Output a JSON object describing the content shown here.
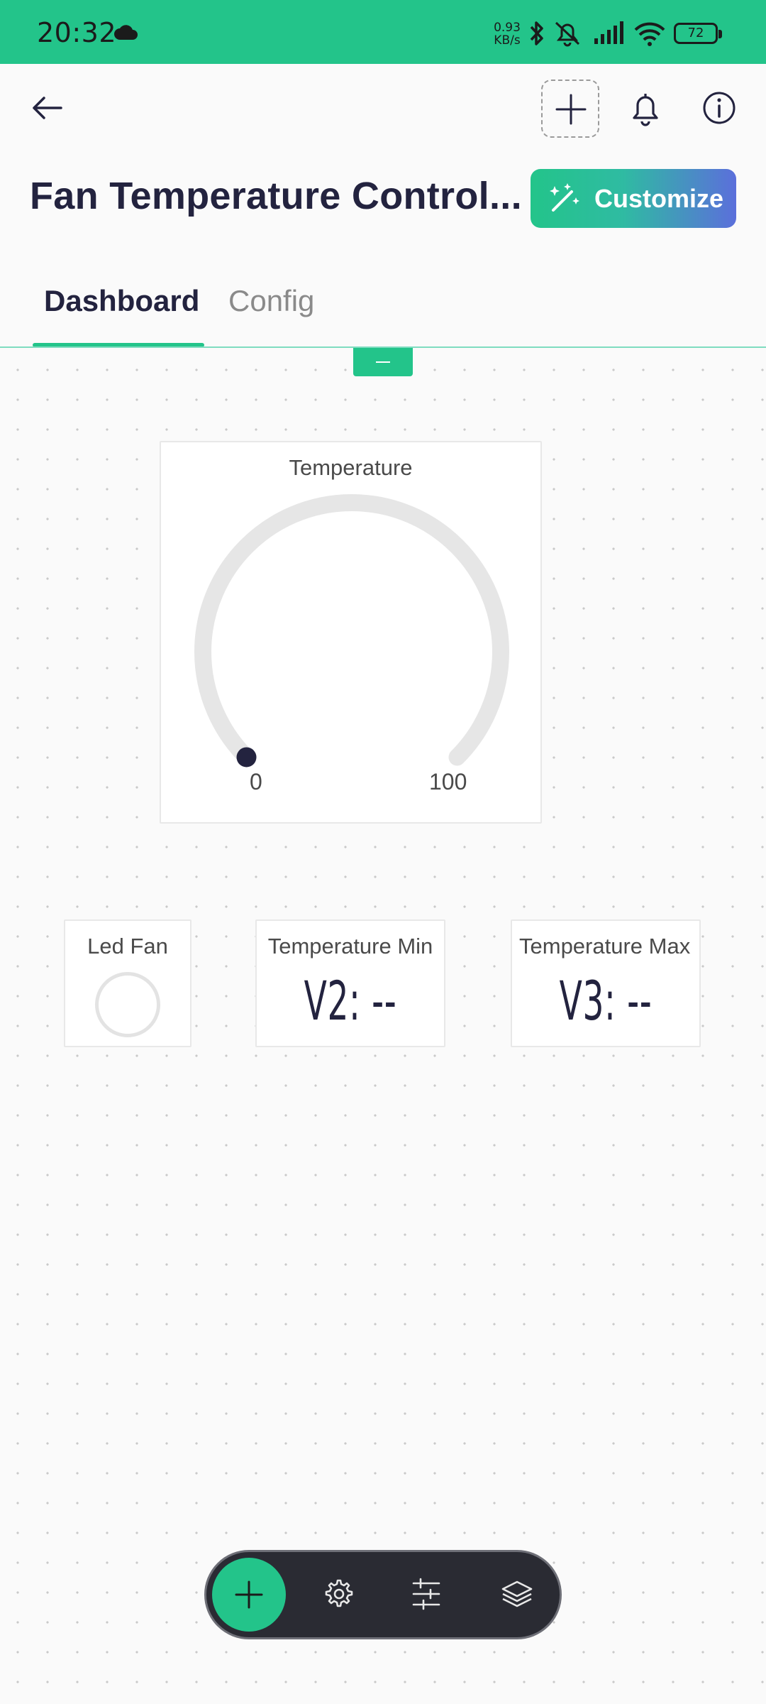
{
  "status_bar": {
    "time": "20:32",
    "net_rate_value": "0.93",
    "net_rate_unit": "KB/s",
    "battery": "72"
  },
  "header": {
    "title": "Fan Temperature Control...",
    "customize_label": "Customize"
  },
  "tabs": [
    {
      "label": "Dashboard",
      "active": true
    },
    {
      "label": "Config",
      "active": false
    }
  ],
  "widgets": {
    "gauge": {
      "title": "Temperature",
      "min_label": "0",
      "max_label": "100",
      "value": 0,
      "min": 0,
      "max": 100
    },
    "led": {
      "title": "Led Fan"
    },
    "temp_min": {
      "title": "Temperature Min",
      "value": "V2: --"
    },
    "temp_max": {
      "title": "Temperature Max",
      "value": "V3: --"
    }
  },
  "toolbar": {
    "icons": [
      "plus-icon",
      "gear-icon",
      "sliders-icon",
      "layers-icon"
    ]
  },
  "colors": {
    "accent": "#23c48a",
    "dark": "#23233f",
    "gradient_end": "#5b6fdb"
  }
}
